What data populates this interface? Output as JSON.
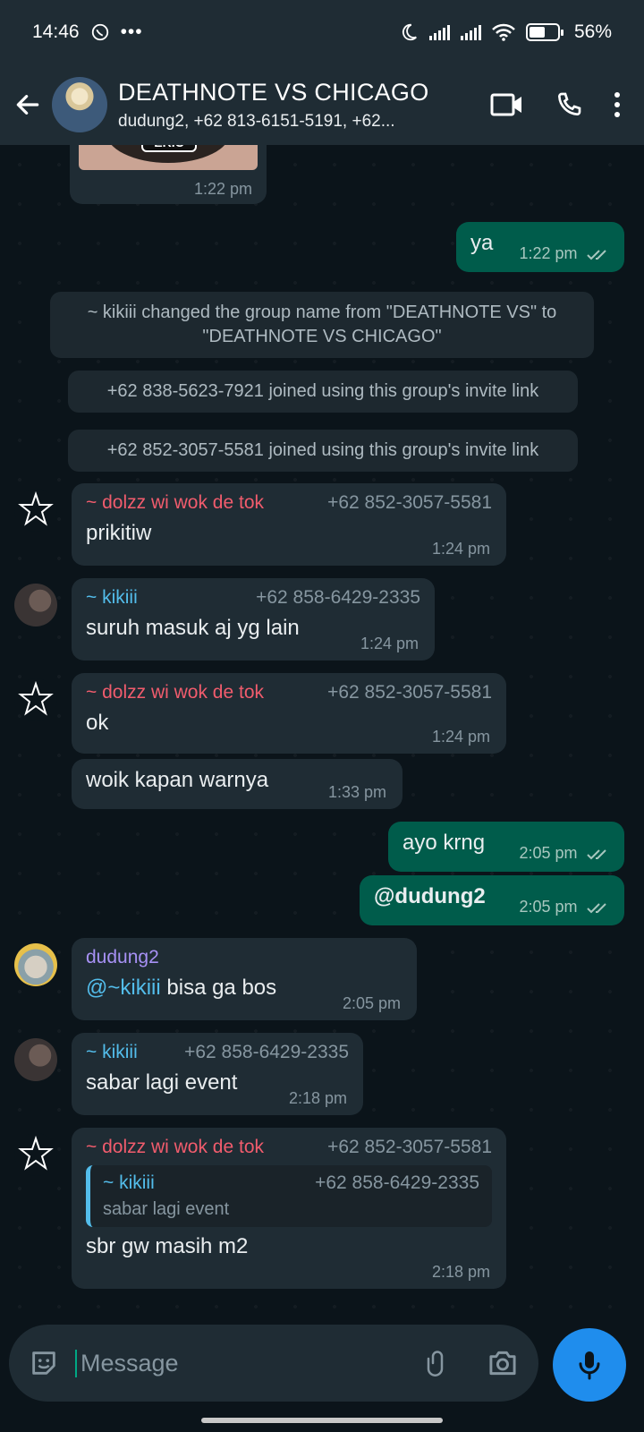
{
  "status_bar": {
    "time": "14:46",
    "battery": "56%",
    "battery_level": 0.56,
    "icons": [
      "whatsapp-icon",
      "more-dots-icon",
      "moon-icon",
      "signal-icon",
      "signal-icon",
      "wifi-icon",
      "battery-icon"
    ]
  },
  "header": {
    "title": "DEATHNOTE VS CHICAGO",
    "subtitle": "dudung2, +62 813-6151-5191, +62...",
    "icons": [
      "back-arrow-icon",
      "video-call-icon",
      "voice-call-icon",
      "menu-dots-icon"
    ]
  },
  "messages": {
    "m0": {
      "time": "1:22 pm",
      "sticker_text": "ERIC"
    },
    "m1": {
      "text": "ya",
      "time": "1:22 pm"
    },
    "sys1": {
      "text": "~ kikiii changed the group name from \"DEATHNOTE VS\" to \"DEATHNOTE VS CHICAGO\""
    },
    "sys2": {
      "text": "+62 838-5623-7921 joined using this group's invite link"
    },
    "sys3": {
      "text": "+62 852-3057-5581 joined using this group's invite link"
    },
    "m2": {
      "sender": "~ dolzz wi wok de tok",
      "phone": "+62 852-3057-5581",
      "text": "prikitiw",
      "time": "1:24 pm"
    },
    "m3": {
      "sender": "~ kikiii",
      "phone": "+62 858-6429-2335",
      "text": "suruh masuk aj yg lain",
      "time": "1:24 pm"
    },
    "m4": {
      "sender": "~ dolzz wi wok de tok",
      "phone": "+62 852-3057-5581",
      "text": "ok",
      "time": "1:24 pm"
    },
    "m5": {
      "text": "woik kapan warnya",
      "time": "1:33 pm"
    },
    "m6": {
      "text": "ayo krng",
      "time": "2:05 pm"
    },
    "m7": {
      "text": "@dudung2",
      "time": "2:05 pm"
    },
    "m8": {
      "sender": "dudung2",
      "mention": "@~kikiii",
      "text": "bisa ga bos",
      "time": "2:05 pm"
    },
    "m9": {
      "sender": "~ kikiii",
      "phone": "+62 858-6429-2335",
      "text": "sabar lagi event",
      "time": "2:18 pm"
    },
    "m10": {
      "sender": "~ dolzz wi wok de tok",
      "phone": "+62 852-3057-5581",
      "quote_sender": "~ kikiii",
      "quote_phone": "+62 858-6429-2335",
      "quote_text": "sabar lagi event",
      "text": "sbr gw masih m2",
      "time": "2:18 pm"
    }
  },
  "composer": {
    "placeholder": "Message",
    "icons": [
      "emoji-icon",
      "attach-icon",
      "camera-icon",
      "mic-icon"
    ]
  },
  "colors": {
    "dolzz": "#f15c6d",
    "kikiii": "#53bdeb",
    "dudung2": "#a791f5",
    "outgoing": "#005c4b",
    "incoming": "#1f2c34",
    "mention": "#53bdeb"
  }
}
